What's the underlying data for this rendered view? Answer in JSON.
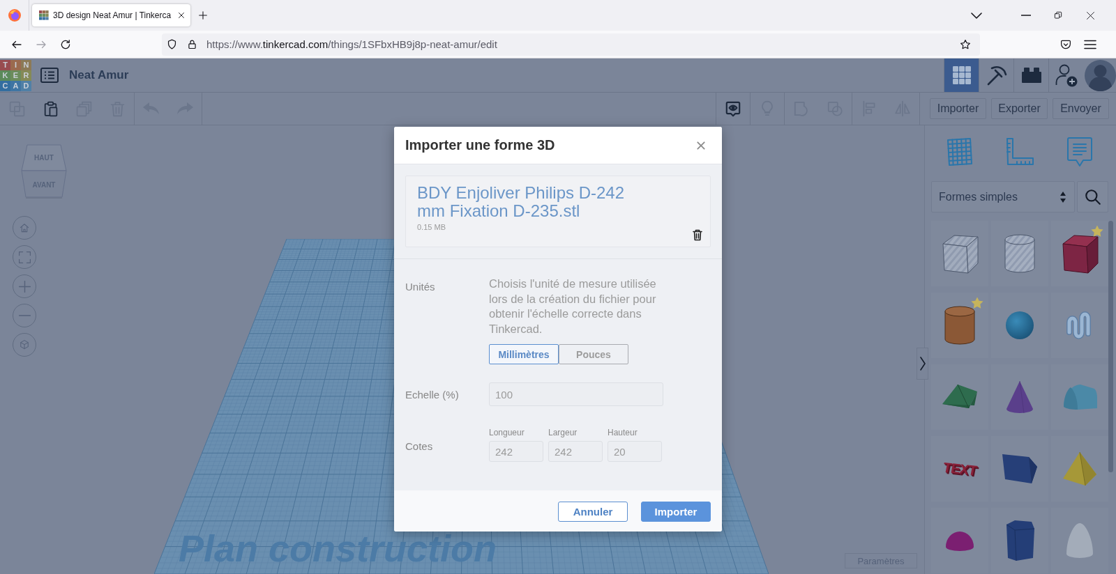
{
  "browser": {
    "tabs": [
      {
        "title": "3D design Neat Amur | Tinkerca",
        "selected": true
      }
    ],
    "address": {
      "scheme": "https://www.",
      "domain": "tinkercad.com",
      "path": "/things/1SFbxHB9j8p-neat-amur/edit"
    }
  },
  "app_header": {
    "logo_letters": [
      "T",
      "I",
      "N",
      "K",
      "E",
      "R",
      "C",
      "A",
      "D"
    ],
    "design_name": "Neat Amur",
    "tools": [
      {
        "kind": "grid",
        "selected": true
      },
      {
        "kind": "pickaxe",
        "selected": false
      },
      {
        "kind": "bricks",
        "selected": false
      }
    ]
  },
  "toolbar": {
    "edit_groups": [
      [
        {
          "kind": "copy",
          "disabled": true
        },
        {
          "kind": "paste",
          "disabled": false
        },
        {
          "kind": "duplicate",
          "disabled": true
        },
        {
          "kind": "delete",
          "disabled": true
        }
      ],
      [
        {
          "kind": "undo",
          "disabled": true
        },
        {
          "kind": "redo",
          "disabled": true
        }
      ]
    ],
    "view_groups": [
      [
        {
          "kind": "notes",
          "disabled": false
        }
      ],
      [
        {
          "kind": "light",
          "disabled": true
        }
      ],
      [
        {
          "kind": "group",
          "disabled": true
        },
        {
          "kind": "ungroup",
          "disabled": true
        }
      ],
      [
        {
          "kind": "align",
          "disabled": true
        },
        {
          "kind": "mirror",
          "disabled": true
        }
      ]
    ],
    "actions": [
      "Importer",
      "Exporter",
      "Envoyer"
    ]
  },
  "view_cube": {
    "top": "HAUT",
    "front": "AVANT"
  },
  "workplane": {
    "label": "Plan construction",
    "settings_button": "Paramètres"
  },
  "shapes_panel": {
    "category": "Formes simples",
    "shapes": [
      {
        "kind": "box_hole",
        "starred": false
      },
      {
        "kind": "cylinder_hole",
        "starred": false
      },
      {
        "kind": "box",
        "starred": true
      },
      {
        "kind": "cylinder",
        "starred": true
      },
      {
        "kind": "sphere",
        "starred": false
      },
      {
        "kind": "scribble",
        "starred": false
      },
      {
        "kind": "roof",
        "starred": false
      },
      {
        "kind": "cone",
        "starred": false
      },
      {
        "kind": "round_roof",
        "starred": false
      },
      {
        "kind": "text",
        "text": "TEXT",
        "starred": false
      },
      {
        "kind": "wedge",
        "starred": false
      },
      {
        "kind": "pyramid",
        "starred": false
      },
      {
        "kind": "half_sphere",
        "starred": false
      },
      {
        "kind": "polygon",
        "starred": false
      },
      {
        "kind": "paraboloid",
        "starred": false
      }
    ]
  },
  "import_dialog": {
    "title": "Importer une forme 3D",
    "file": {
      "name": "BDY Enjoliver Philips D-242 mm Fixation D-235.stl",
      "size": "0.15 MB"
    },
    "units": {
      "label": "Unités",
      "description": "Choisis l'unité de mesure utilisée lors de la création du fichier pour obtenir l'échelle correcte dans Tinkercad.",
      "options": [
        {
          "label": "Millimètres",
          "selected": true
        },
        {
          "label": "Pouces",
          "selected": false
        }
      ]
    },
    "scale": {
      "label": "Echelle (%)",
      "value": "100"
    },
    "dimensions": {
      "label": "Cotes",
      "fields": [
        {
          "label": "Longueur",
          "value": "242"
        },
        {
          "label": "Largeur",
          "value": "242"
        },
        {
          "label": "Hauteur",
          "value": "20"
        }
      ]
    },
    "buttons": [
      {
        "label": "Annuler",
        "kind": "secondary"
      },
      {
        "label": "Importer",
        "kind": "primary"
      }
    ]
  }
}
